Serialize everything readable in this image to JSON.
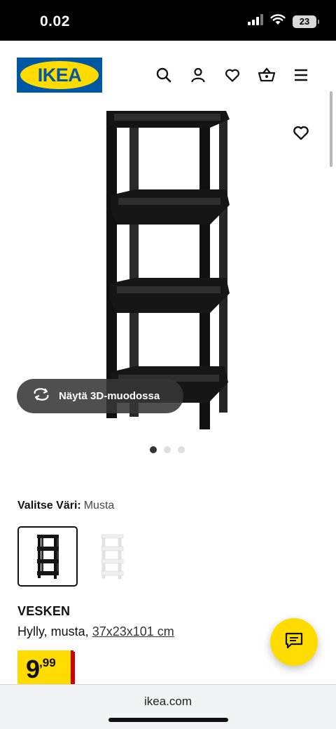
{
  "status_bar": {
    "time": "0.02",
    "battery": "23"
  },
  "header": {
    "logo_text": "IKEA",
    "icons": [
      "search-icon",
      "account-icon",
      "wishlist-icon",
      "cart-icon",
      "menu-icon"
    ]
  },
  "gallery": {
    "view_3d_label": "Näytä 3D-muodossa",
    "image_count": 3,
    "active_index": 0
  },
  "color": {
    "label": "Valitse Väri:",
    "value": "Musta",
    "options": [
      "Musta",
      "Valkoinen"
    ],
    "selected": "Musta"
  },
  "product": {
    "name": "VESKEN",
    "description": "Hylly, musta,",
    "size": "37x23x101 cm",
    "price_int": "9",
    "price_dec": ",99"
  },
  "browser": {
    "url": "ikea.com"
  },
  "colors": {
    "ikea_blue": "#0058a3",
    "ikea_yellow": "#ffdb00",
    "price_red": "#cc0008"
  }
}
